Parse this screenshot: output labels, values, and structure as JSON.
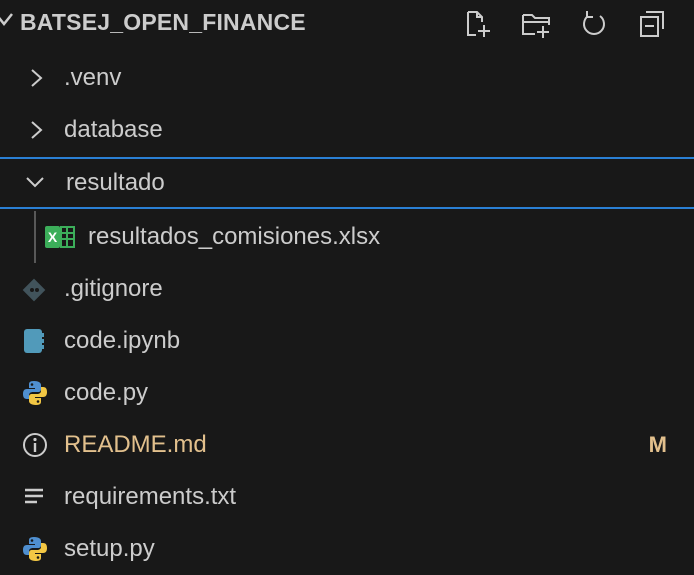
{
  "explorer": {
    "title": "BATSEJ_OPEN_FINANCE",
    "actions": [
      {
        "name": "new-file",
        "icon": "new-file-icon"
      },
      {
        "name": "new-folder",
        "icon": "new-folder-icon"
      },
      {
        "name": "refresh",
        "icon": "refresh-icon"
      },
      {
        "name": "collapse-all",
        "icon": "collapse-all-icon"
      }
    ],
    "items": [
      {
        "label": ".venv",
        "kind": "folder",
        "state": "collapsed"
      },
      {
        "label": "database",
        "kind": "folder",
        "state": "collapsed"
      },
      {
        "label": "resultado",
        "kind": "folder",
        "state": "expanded"
      },
      {
        "label": "resultados_comisiones.xlsx",
        "kind": "file",
        "icon": "excel-icon"
      },
      {
        "label": ".gitignore",
        "kind": "file",
        "icon": "git-icon"
      },
      {
        "label": "code.ipynb",
        "kind": "file",
        "icon": "notebook-icon"
      },
      {
        "label": "code.py",
        "kind": "file",
        "icon": "python-icon"
      },
      {
        "label": "README.md",
        "kind": "file",
        "icon": "info-icon",
        "badge": "M"
      },
      {
        "label": "requirements.txt",
        "kind": "file",
        "icon": "text-lines-icon"
      },
      {
        "label": "setup.py",
        "kind": "file",
        "icon": "python-icon"
      }
    ]
  },
  "colors": {
    "background": "#181818",
    "text": "#cccccc",
    "modified": "#e2c08d",
    "focus_border": "#2a7fd4",
    "excel": "#3cae5a",
    "python_blue": "#4f8fd0",
    "python_yellow": "#f2c744",
    "notebook": "#519aba",
    "info": "#cccccc",
    "gitignore": "#41535b"
  }
}
